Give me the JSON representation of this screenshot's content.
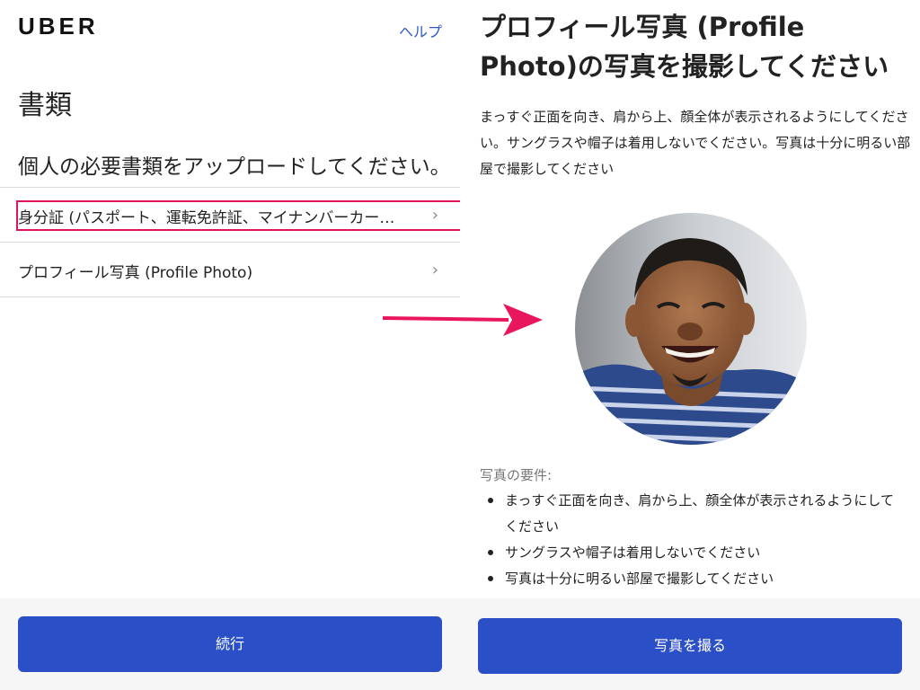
{
  "left": {
    "logo": "UBER",
    "help": "ヘルプ",
    "title": "書類",
    "subtitle": "個人の必要書類をアップロードしてください。",
    "items": [
      {
        "label": "身分証 (パスポート、運転免許証、マイナンバーカード..."
      },
      {
        "label": "プロフィール写真 (Profile Photo)"
      }
    ],
    "chevron": "›",
    "continue_label": "続行"
  },
  "right": {
    "title": "プロフィール写真 (Profile Photo)の写真を撮影してください",
    "description": "まっすぐ正面を向き、肩から上、顔全体が表示されるようにしてください。サングラスや帽子は着用しないでください。写真は十分に明るい部屋で撮影してください",
    "requirements_title": "写真の要件:",
    "requirements": [
      "まっすぐ正面を向き、肩から上、顔全体が表示されるようにしてください",
      "サングラスや帽子は着用しないでください",
      "写真は十分に明るい部屋で撮影してください"
    ],
    "take_photo_label": "写真を撮る"
  },
  "colors": {
    "accent": "#2b4fc7",
    "link": "#2f57c8",
    "highlight": "#e0145e"
  }
}
